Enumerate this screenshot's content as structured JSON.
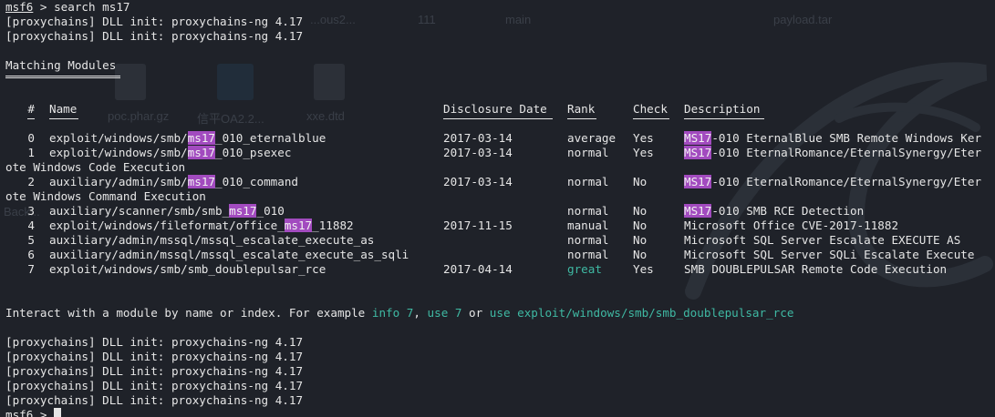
{
  "wallpaper": {
    "labels": [
      "...ous2...",
      "111",
      "main",
      "payload.tar",
      "poc.phar.gz",
      "信平OA2.2...",
      "xxe.dtd",
      "Back..."
    ]
  },
  "terminal": {
    "prompt": "msf6",
    "command": " > search ms17",
    "init_line": "[proxychains] DLL init: proxychains-ng 4.17",
    "matching_title": "Matching Modules",
    "matching_underline": "================",
    "headers": {
      "num": "#",
      "name": "Name",
      "date": "Disclosure Date",
      "rank": "Rank",
      "check": "Check",
      "desc": "Description"
    },
    "highlight_term_lower": "ms17",
    "highlight_term_upper": "MS17",
    "modules": [
      {
        "num": "0",
        "name_pre": "exploit/windows/smb/",
        "name_hl": "ms17",
        "name_post": "_010_eternalblue",
        "date": "2017-03-14",
        "rank": "average",
        "check": "Yes",
        "desc_hl": "MS17",
        "desc_post": "-010 EternalBlue SMB Remote Windows Ker",
        "wrap": ""
      },
      {
        "num": "1",
        "name_pre": "exploit/windows/smb/",
        "name_hl": "ms17",
        "name_post": "_010_psexec",
        "date": "2017-03-14",
        "rank": "normal",
        "check": "Yes",
        "desc_hl": "MS17",
        "desc_post": "-010 EternalRomance/EternalSynergy/Eter",
        "wrap": "ote Windows Code Execution"
      },
      {
        "num": "2",
        "name_pre": "auxiliary/admin/smb/",
        "name_hl": "ms17",
        "name_post": "_010_command",
        "date": "2017-03-14",
        "rank": "normal",
        "check": "No",
        "desc_hl": "MS17",
        "desc_post": "-010 EternalRomance/EternalSynergy/Eter",
        "wrap": "ote Windows Command Execution"
      },
      {
        "num": "3",
        "name_pre": "auxiliary/scanner/smb/smb_",
        "name_hl": "ms17",
        "name_post": "_010",
        "date": "",
        "rank": "normal",
        "check": "No",
        "desc_hl": "MS17",
        "desc_post": "-010 SMB RCE Detection",
        "wrap": ""
      },
      {
        "num": "4",
        "name_pre": "exploit/windows/fileformat/office_",
        "name_hl": "ms17",
        "name_post": "_11882",
        "date": "2017-11-15",
        "rank": "manual",
        "check": "No",
        "desc_hl": "",
        "desc_post": "Microsoft Office CVE-2017-11882",
        "wrap": ""
      },
      {
        "num": "5",
        "name_pre": "auxiliary/admin/mssql/mssql_escalate_execute_as",
        "name_hl": "",
        "name_post": "",
        "date": "",
        "rank": "normal",
        "check": "No",
        "desc_hl": "",
        "desc_post": "Microsoft SQL Server Escalate EXECUTE AS",
        "wrap": ""
      },
      {
        "num": "6",
        "name_pre": "auxiliary/admin/mssql/mssql_escalate_execute_as_sqli",
        "name_hl": "",
        "name_post": "",
        "date": "",
        "rank": "normal",
        "check": "No",
        "desc_hl": "",
        "desc_post": "Microsoft SQL Server SQLi Escalate Execute",
        "wrap": ""
      },
      {
        "num": "7",
        "name_pre": "exploit/windows/smb/smb_doublepulsar_rce",
        "name_hl": "",
        "name_post": "",
        "date": "2017-04-14",
        "rank": "great",
        "check": "Yes",
        "desc_hl": "",
        "desc_post": "SMB DOUBLEPULSAR Remote Code Execution",
        "wrap": ""
      }
    ],
    "interact": {
      "pre": "Interact with a module by name or index. For example ",
      "info": "info 7",
      "comma": ", ",
      "use": "use 7",
      "or": " or ",
      "use_full": "use exploit/windows/smb/smb_doublepulsar_rce"
    },
    "final_prompt": "msf6",
    "final_prompt_suffix": " > "
  },
  "colors": {
    "background": "#1f2229",
    "text": "#e6e6e6",
    "highlight": "#a24bbf",
    "link": "#3fb9a3"
  }
}
